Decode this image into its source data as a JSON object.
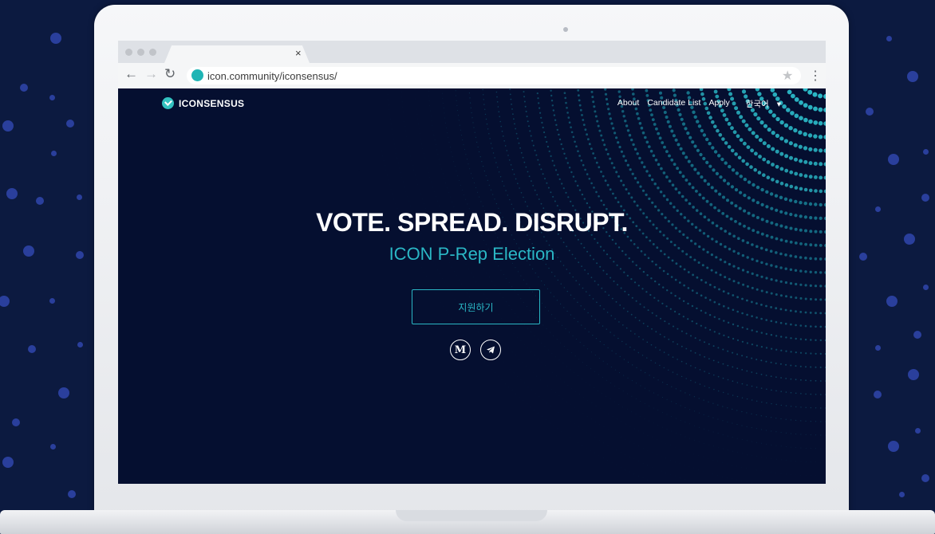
{
  "browser": {
    "url": "icon.community/iconsensus/",
    "tab_close": "×",
    "nav_icons": [
      "back-arrow-icon",
      "forward-arrow-icon",
      "reload-icon"
    ],
    "star_icon": "★",
    "menu_icon": "⋮"
  },
  "site": {
    "logo_text": "ICONSENSUS",
    "nav": [
      "About",
      "Candidate List",
      "Apply",
      "한국어"
    ],
    "language_caret": "▾"
  },
  "hero": {
    "title": "VOTE. SPREAD. DISRUPT.",
    "subtitle": "ICON P-Rep Election",
    "button": "지원하기",
    "social": [
      "M",
      "telegram"
    ]
  },
  "colors": {
    "accent": "#2ab7c5",
    "page_bg": "#050f30",
    "backdrop": "#0c1a40"
  }
}
